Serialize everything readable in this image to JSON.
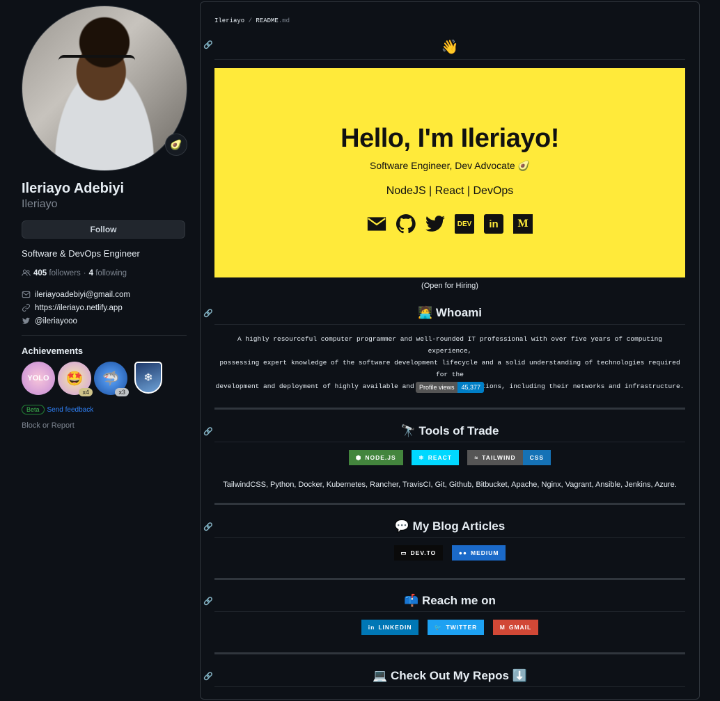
{
  "profile": {
    "full_name": "Ileriayo Adebiyi",
    "login": "Ileriayo",
    "status_emoji": "🥑",
    "follow_label": "Follow",
    "bio": "Software & DevOps Engineer",
    "followers_count": "405",
    "followers_label": "followers",
    "separator": "·",
    "following_count": "4",
    "following_label": "following",
    "email": "ileriayoadebiyi@gmail.com",
    "website": "https://ileriayo.netlify.app",
    "twitter": "@ileriayooo",
    "achievements_title": "Achievements",
    "achievements": [
      {
        "name": "yolo",
        "glyph": "YOLO",
        "count": ""
      },
      {
        "name": "quickdraw",
        "glyph": "🤩",
        "count": "x4"
      },
      {
        "name": "pull-shark",
        "glyph": "🦈",
        "count": "x3"
      },
      {
        "name": "arctic-code-vault",
        "glyph": "❄",
        "count": ""
      }
    ],
    "beta_label": "Beta",
    "feedback_label": "Send feedback",
    "block_label": "Block or Report"
  },
  "readme": {
    "crumb_user": "Ileriayo",
    "crumb_sep": " / ",
    "crumb_file": "README",
    "crumb_ext": ".md",
    "wave": "👋",
    "banner": {
      "hello": "Hello, I'm Ileriayo!",
      "subtitle": "Software Engineer, Dev Advocate 🥑",
      "stack": "NodeJS | React | DevOps",
      "icons": [
        "mail-icon",
        "github-icon",
        "twitter-icon",
        "dev-icon",
        "linkedin-icon",
        "medium-icon"
      ]
    },
    "open_hiring": "(Open for Hiring)",
    "whoami_heading": "🧑‍💻 Whoami",
    "whoami_text_1": "A highly resourceful computer programmer and well-rounded IT professional with over five years of computing experience,",
    "whoami_text_2": "possessing expert knowledge of the software development lifecycle and a solid understanding of technologies required for the",
    "whoami_text_3": "development and deployment of highly available and scalable applications, including their networks and infrastructure.",
    "profile_views_label": "Profile views",
    "profile_views_value": "45,377",
    "tools_heading": "🔭 Tools of Trade",
    "tool_badges": [
      {
        "label": "NODE.JS",
        "color": "#43853d"
      },
      {
        "label": "REACT",
        "color": "#20232a"
      },
      {
        "label": "TAILWIND",
        "color": "#38b2ac"
      },
      {
        "label": "CSS",
        "color": "#1572b6"
      }
    ],
    "tools_list": "TailwindCSS, Python, Docker, Kubernetes, Rancher, TravisCI, Git, Github, Bitbucket, Apache, Nginx, Vagrant, Ansible, Jenkins, Azure.",
    "blog_heading": "💬 My Blog Articles",
    "blog_badges": [
      {
        "label": "DEV.TO",
        "color": "#0a0a0a"
      },
      {
        "label": "MEDIUM",
        "color": "#12100e"
      }
    ],
    "reach_heading": "📫 Reach me on",
    "reach_badges": [
      {
        "label": "LINKEDIN",
        "color": "#0077b5"
      },
      {
        "label": "TWITTER",
        "color": "#1da1f2"
      },
      {
        "label": "GMAIL",
        "color": "#d14836"
      }
    ],
    "repos_heading": "💻 Check Out My Repos ⬇️"
  }
}
